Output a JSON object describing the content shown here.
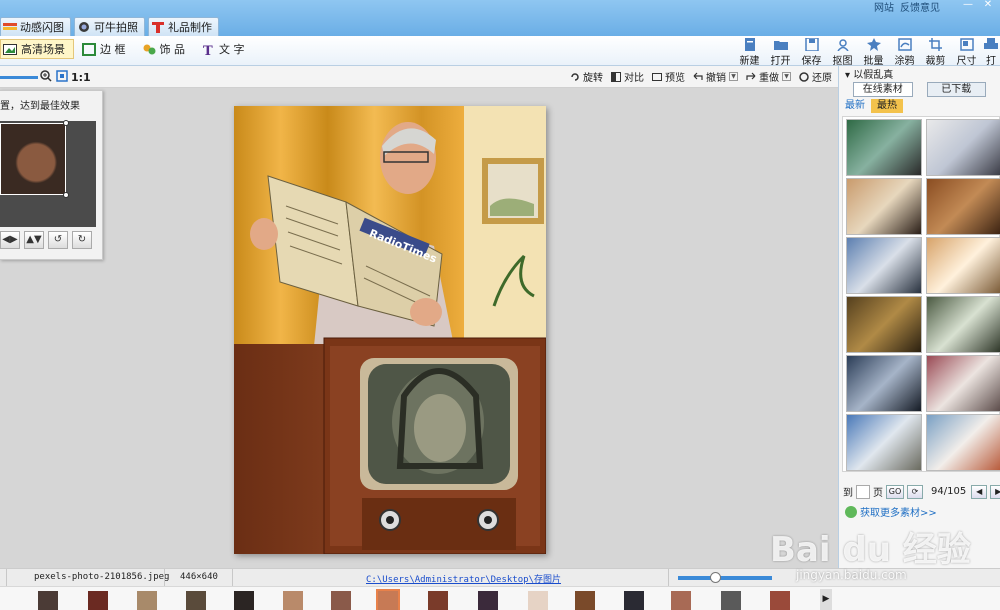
{
  "top_tabs": [
    {
      "label": "动感闪图",
      "icon": "flash-icon"
    },
    {
      "label": "可牛拍照",
      "icon": "camera-icon"
    },
    {
      "label": "礼品制作",
      "icon": "gift-icon"
    }
  ],
  "top_right_links": {
    "site": "网站",
    "feedback": "反馈意见"
  },
  "edit_modes": [
    {
      "label": "高清场景",
      "icon": "scene-icon",
      "active": true
    },
    {
      "label": "边 框",
      "icon": "frame-icon",
      "active": false
    },
    {
      "label": "饰 品",
      "icon": "ornament-icon",
      "active": false
    },
    {
      "label": "文 字",
      "icon": "text-icon",
      "active": false
    }
  ],
  "file_tools": [
    {
      "label": "新建",
      "icon": "new-file-icon"
    },
    {
      "label": "打开",
      "icon": "open-folder-icon"
    },
    {
      "label": "保存",
      "icon": "save-icon"
    },
    {
      "label": "抠图",
      "icon": "cutout-icon"
    },
    {
      "label": "批量",
      "icon": "batch-icon"
    },
    {
      "label": "涂鸦",
      "icon": "doodle-icon"
    },
    {
      "label": "裁剪",
      "icon": "crop-icon"
    },
    {
      "label": "尺寸",
      "icon": "resize-icon"
    },
    {
      "label": "打",
      "icon": "print-icon"
    }
  ],
  "zoom": {
    "fit_label": "1:1"
  },
  "edit_actions": [
    {
      "label": "旋转",
      "icon": "rotate-icon",
      "dropdown": false
    },
    {
      "label": "对比",
      "icon": "compare-icon",
      "dropdown": false
    },
    {
      "label": "预览",
      "icon": "preview-icon",
      "dropdown": false
    },
    {
      "label": "撤销",
      "icon": "undo-icon",
      "dropdown": true
    },
    {
      "label": "重做",
      "icon": "redo-icon",
      "dropdown": true
    },
    {
      "label": "还原",
      "icon": "restore-icon",
      "dropdown": false
    }
  ],
  "left_panel": {
    "hint": "置，达到最佳效果"
  },
  "right_panel": {
    "title": "以假乱真",
    "tabs": [
      {
        "label": "在线素材",
        "active": true
      },
      {
        "label": "已下载",
        "active": false
      }
    ],
    "subtabs": [
      {
        "label": "最新",
        "active": false
      },
      {
        "label": "最热",
        "active": true
      }
    ],
    "pager": {
      "prefix": "到",
      "suffix": "页",
      "go": "GO",
      "page_info": "94/105"
    },
    "more_link": "获取更多素材>>"
  },
  "status": {
    "filename": "pexels-photo-2101856.jpeg",
    "dimensions": "446×640",
    "path": "C:\\Users\\Administrator\\Desktop\\存图片"
  },
  "watermark": {
    "text": "Bai du 经验",
    "sub": "jingyan.baidu.com"
  }
}
